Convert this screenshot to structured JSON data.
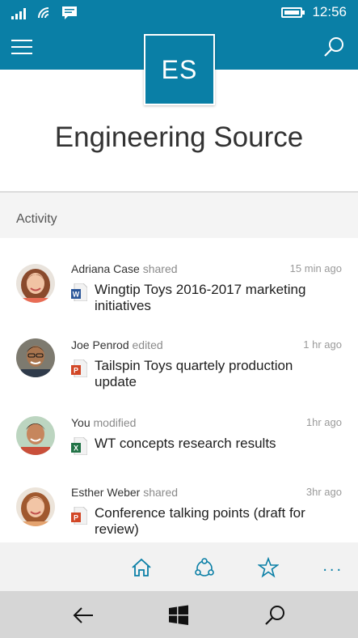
{
  "status_bar": {
    "time": "12:56"
  },
  "header": {
    "logo_initials": "ES",
    "site_title": "Engineering Source"
  },
  "activity": {
    "section_label": "Activity",
    "items": [
      {
        "user": "Adriana Case",
        "action": "shared",
        "time": "15 min ago",
        "doc_type": "word",
        "title": "Wingtip Toys 2016-2017 marketing initiatives"
      },
      {
        "user": "Joe Penrod",
        "action": "edited",
        "time": "1 hr ago",
        "doc_type": "powerpoint",
        "title": "Tailspin Toys quartely production update"
      },
      {
        "user": "You",
        "action": "modified",
        "time": "1hr ago",
        "doc_type": "excel",
        "title": "WT concepts research results"
      },
      {
        "user": "Esther Weber",
        "action": "shared",
        "time": "3hr ago",
        "doc_type": "powerpoint",
        "title": "Conference talking points (draft for review)"
      }
    ]
  },
  "bottom_bar": {
    "more": "..."
  },
  "colors": {
    "accent": "#0a7fa6",
    "word": "#2b579a",
    "powerpoint": "#d24726",
    "excel": "#217346"
  },
  "icons": {
    "signal": "signal-icon",
    "wifi": "wifi-icon",
    "message": "message-icon",
    "battery": "battery-icon",
    "menu": "hamburger-icon",
    "search": "search-icon",
    "home": "home-icon",
    "groups": "groups-icon",
    "favorite": "star-icon",
    "back": "back-arrow-icon",
    "windows": "windows-icon"
  }
}
